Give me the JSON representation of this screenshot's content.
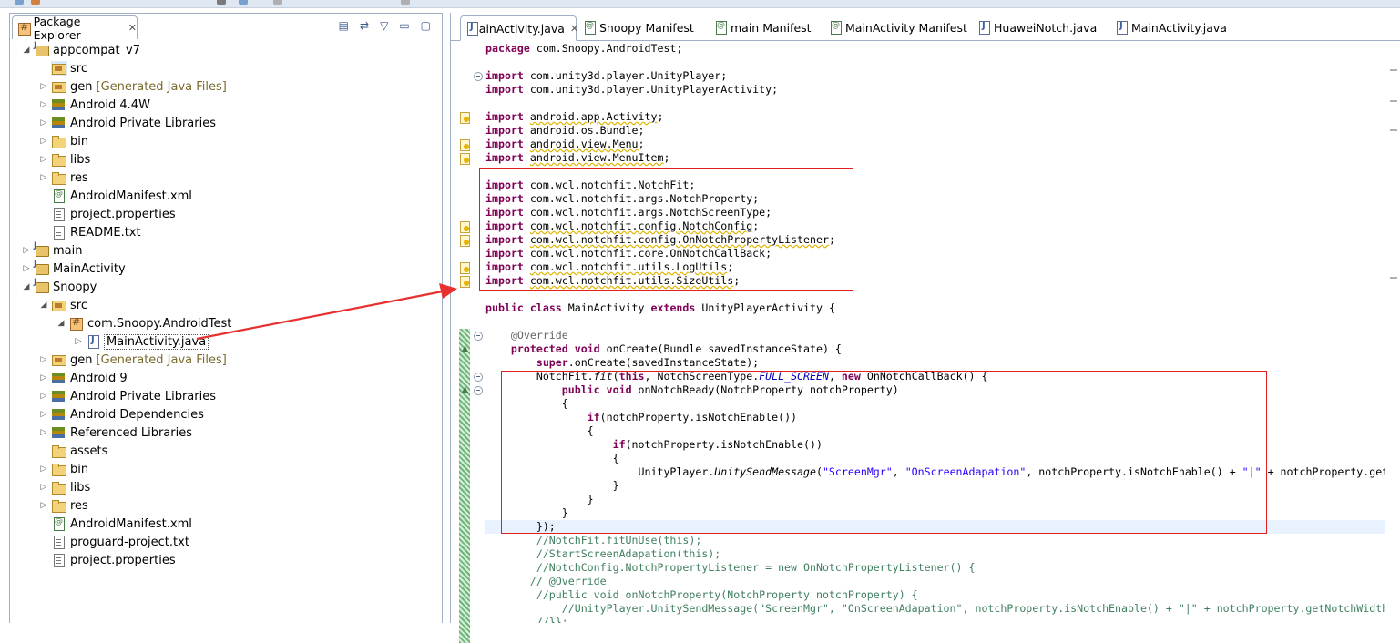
{
  "explorer": {
    "title": "Package Explorer",
    "close_glyph": "✕",
    "tools": [
      "▤",
      "⇄",
      "▽",
      "▭",
      "▢"
    ],
    "tree": [
      {
        "label": "appcompat_v7",
        "icon": "project-icon",
        "twisty": "◢",
        "depth": 0
      },
      {
        "label": "src",
        "icon": "source-folder-icon",
        "twisty": "",
        "depth": 1,
        "selected": true
      },
      {
        "label": "gen",
        "decoration": "[Generated Java Files]",
        "icon": "source-folder-icon",
        "twisty": "▷",
        "depth": 1
      },
      {
        "label": "Android 4.4W",
        "icon": "library-icon",
        "twisty": "▷",
        "depth": 1
      },
      {
        "label": "Android Private Libraries",
        "icon": "library-icon",
        "twisty": "▷",
        "depth": 1
      },
      {
        "label": "bin",
        "icon": "folder-icon",
        "twisty": "▷",
        "depth": 1
      },
      {
        "label": "libs",
        "icon": "folder-icon",
        "twisty": "▷",
        "depth": 1
      },
      {
        "label": "res",
        "icon": "folder-icon",
        "twisty": "▷",
        "depth": 1
      },
      {
        "label": "AndroidManifest.xml",
        "icon": "xml-file-icon",
        "twisty": "",
        "depth": 1
      },
      {
        "label": "project.properties",
        "icon": "file-icon",
        "twisty": "",
        "depth": 1
      },
      {
        "label": "README.txt",
        "icon": "file-icon",
        "twisty": "",
        "depth": 1
      },
      {
        "label": "main",
        "icon": "project-icon",
        "twisty": "▷",
        "depth": 0
      },
      {
        "label": "MainActivity",
        "icon": "project-icon",
        "twisty": "▷",
        "depth": 0
      },
      {
        "label": "Snoopy",
        "icon": "project-icon",
        "twisty": "◢",
        "depth": 0
      },
      {
        "label": "src",
        "icon": "source-folder-icon",
        "twisty": "◢",
        "depth": 1
      },
      {
        "label": "com.Snoopy.AndroidTest",
        "icon": "package-icon",
        "twisty": "◢",
        "depth": 2
      },
      {
        "label": "MainActivity.java",
        "icon": "java-file-icon",
        "twisty": "▷",
        "depth": 3,
        "selected": true
      },
      {
        "label": "gen",
        "decoration": "[Generated Java Files]",
        "icon": "source-folder-icon",
        "twisty": "▷",
        "depth": 1
      },
      {
        "label": "Android 9",
        "icon": "library-icon",
        "twisty": "▷",
        "depth": 1
      },
      {
        "label": "Android Private Libraries",
        "icon": "library-icon",
        "twisty": "▷",
        "depth": 1
      },
      {
        "label": "Android Dependencies",
        "icon": "library-icon",
        "twisty": "▷",
        "depth": 1
      },
      {
        "label": "Referenced Libraries",
        "icon": "library-icon",
        "twisty": "▷",
        "depth": 1
      },
      {
        "label": "assets",
        "icon": "folder-icon",
        "twisty": "",
        "depth": 1
      },
      {
        "label": "bin",
        "icon": "folder-icon",
        "twisty": "▷",
        "depth": 1
      },
      {
        "label": "libs",
        "icon": "folder-icon",
        "twisty": "▷",
        "depth": 1
      },
      {
        "label": "res",
        "icon": "folder-icon",
        "twisty": "▷",
        "depth": 1
      },
      {
        "label": "AndroidManifest.xml",
        "icon": "xml-file-icon",
        "twisty": "",
        "depth": 1
      },
      {
        "label": "proguard-project.txt",
        "icon": "file-icon",
        "twisty": "",
        "depth": 1
      },
      {
        "label": "project.properties",
        "icon": "file-icon",
        "twisty": "",
        "depth": 1
      }
    ]
  },
  "editor": {
    "tabs": [
      {
        "label": "MainActivity.java",
        "icon": "java-file-icon",
        "active": true,
        "close": "✕"
      },
      {
        "label": "Snoopy Manifest",
        "icon": "xml-file-icon"
      },
      {
        "label": "main Manifest",
        "icon": "xml-file-icon"
      },
      {
        "label": "MainActivity Manifest",
        "icon": "xml-file-icon"
      },
      {
        "label": "HuaweiNotch.java",
        "icon": "java-file-icon"
      },
      {
        "label": "MainActivity.java",
        "icon": "java-file-icon"
      }
    ],
    "lines": [
      [
        [
          "k",
          "package"
        ],
        [
          "n",
          " com.Snoopy.AndroidTest;"
        ]
      ],
      [],
      [
        [
          "k",
          "import"
        ],
        [
          "n",
          " com.unity3d.player.UnityPlayer;"
        ]
      ],
      [
        [
          "k",
          "import"
        ],
        [
          "n",
          " com.unity3d.player.UnityPlayerActivity;"
        ]
      ],
      [],
      [
        [
          "k",
          "import"
        ],
        [
          "n",
          " "
        ],
        [
          "w",
          "android.app.Activity"
        ],
        [
          "n",
          ";"
        ]
      ],
      [
        [
          "k",
          "import"
        ],
        [
          "n",
          " android.os.Bundle;"
        ]
      ],
      [
        [
          "k",
          "import"
        ],
        [
          "n",
          " "
        ],
        [
          "w",
          "android.view.Menu"
        ],
        [
          "n",
          ";"
        ]
      ],
      [
        [
          "k",
          "import"
        ],
        [
          "n",
          " "
        ],
        [
          "w",
          "android.view.MenuItem"
        ],
        [
          "n",
          ";"
        ]
      ],
      [],
      [
        [
          "k",
          "import"
        ],
        [
          "n",
          " com.wcl.notchfit.NotchFit;"
        ]
      ],
      [
        [
          "k",
          "import"
        ],
        [
          "n",
          " com.wcl.notchfit.args.NotchProperty;"
        ]
      ],
      [
        [
          "k",
          "import"
        ],
        [
          "n",
          " com.wcl.notchfit.args.NotchScreenType;"
        ]
      ],
      [
        [
          "k",
          "import"
        ],
        [
          "n",
          " "
        ],
        [
          "w",
          "com.wcl.notchfit.config.NotchConfig"
        ],
        [
          "n",
          ";"
        ]
      ],
      [
        [
          "k",
          "import"
        ],
        [
          "n",
          " "
        ],
        [
          "w",
          "com.wcl.notchfit.config.OnNotchPropertyListener"
        ],
        [
          "n",
          ";"
        ]
      ],
      [
        [
          "k",
          "import"
        ],
        [
          "n",
          " com.wcl.notchfit.core.OnNotchCallBack;"
        ]
      ],
      [
        [
          "k",
          "import"
        ],
        [
          "n",
          " "
        ],
        [
          "w",
          "com.wcl.notchfit.utils.LogUtils"
        ],
        [
          "n",
          ";"
        ]
      ],
      [
        [
          "k",
          "import"
        ],
        [
          "n",
          " "
        ],
        [
          "w",
          "com.wcl.notchfit.utils.SizeUtils"
        ],
        [
          "n",
          ";"
        ]
      ],
      [],
      [
        [
          "k",
          "public"
        ],
        [
          "n",
          " "
        ],
        [
          "k",
          "class"
        ],
        [
          "n",
          " MainActivity "
        ],
        [
          "k",
          "extends"
        ],
        [
          "n",
          " UnityPlayerActivity {"
        ]
      ],
      [],
      [
        [
          "n",
          "    "
        ],
        [
          "a",
          "@Override"
        ]
      ],
      [
        [
          "n",
          "    "
        ],
        [
          "k",
          "protected"
        ],
        [
          "n",
          " "
        ],
        [
          "k",
          "void"
        ],
        [
          "n",
          " onCreate(Bundle savedInstanceState) {"
        ]
      ],
      [
        [
          "n",
          "        "
        ],
        [
          "k",
          "super"
        ],
        [
          "n",
          ".onCreate(savedInstanceState);"
        ]
      ],
      [
        [
          "n",
          "        NotchFit."
        ],
        [
          "i",
          "fit"
        ],
        [
          "n",
          "("
        ],
        [
          "k",
          "this"
        ],
        [
          "n",
          ", NotchScreenType."
        ],
        [
          "f",
          "FULL_SCREEN"
        ],
        [
          "n",
          ", "
        ],
        [
          "k",
          "new"
        ],
        [
          "n",
          " OnNotchCallBack() {"
        ]
      ],
      [
        [
          "n",
          "            "
        ],
        [
          "k",
          "public"
        ],
        [
          "n",
          " "
        ],
        [
          "k",
          "void"
        ],
        [
          "n",
          " onNotchReady(NotchProperty notchProperty)"
        ]
      ],
      [
        [
          "n",
          "            {"
        ]
      ],
      [
        [
          "n",
          "                "
        ],
        [
          "k",
          "if"
        ],
        [
          "n",
          "(notchProperty.isNotchEnable())"
        ]
      ],
      [
        [
          "n",
          "                {"
        ]
      ],
      [
        [
          "n",
          "                    "
        ],
        [
          "k",
          "if"
        ],
        [
          "n",
          "(notchProperty.isNotchEnable())"
        ]
      ],
      [
        [
          "n",
          "                    {"
        ]
      ],
      [
        [
          "n",
          "                        UnityPlayer."
        ],
        [
          "i",
          "UnitySendMessage"
        ],
        [
          "n",
          "("
        ],
        [
          "s",
          "\"ScreenMgr\""
        ],
        [
          "n",
          ", "
        ],
        [
          "s",
          "\"OnScreenAdapation\""
        ],
        [
          "n",
          ", notchProperty.isNotchEnable() + "
        ],
        [
          "s",
          "\"|\""
        ],
        [
          "n",
          " + notchProperty.getNotchWidth"
        ]
      ],
      [
        [
          "n",
          "                    }"
        ]
      ],
      [
        [
          "n",
          "                }"
        ]
      ],
      [
        [
          "n",
          "            }"
        ]
      ],
      [
        [
          "n",
          "        });"
        ]
      ],
      [
        [
          "c",
          "        //NotchFit.fitUnUse(this);"
        ]
      ],
      [
        [
          "c",
          "        //StartScreenAdapation(this);"
        ]
      ],
      [
        [
          "c",
          "        //NotchConfig.NotchPropertyListener = new OnNotchPropertyListener() {"
        ]
      ],
      [
        [
          "c",
          "       // @Override"
        ]
      ],
      [
        [
          "c",
          "        //public void onNotchProperty(NotchProperty notchProperty) {"
        ]
      ],
      [
        [
          "c",
          "            //UnityPlayer.UnitySendMessage(\"ScreenMgr\", \"OnScreenAdapation\", notchProperty.isNotchEnable() + \"|\" + notchProperty.getNotchWidth"
        ]
      ],
      [
        [
          "c",
          "        //}};"
        ]
      ]
    ]
  },
  "colors": {
    "keyword": "#7f0055",
    "comment": "#3f7f5f",
    "string": "#2a00ff",
    "annotation_box": "#e02020"
  }
}
